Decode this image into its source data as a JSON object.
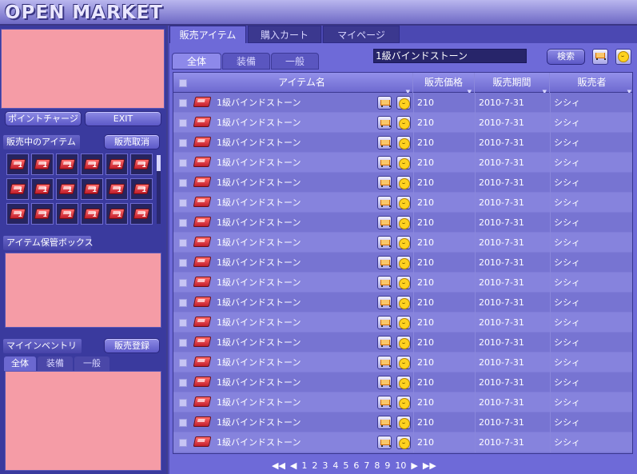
{
  "app": {
    "title": "OPEN MARKET"
  },
  "left": {
    "point_charge": "ポイントチャージ",
    "exit": "EXIT",
    "selling_label": "販売中のアイテム",
    "cancel_sale": "販売取消",
    "storage_label": "アイテム保管ボックス",
    "inventory_label": "マイインベントリ",
    "register_sale": "販売登録",
    "inv_tabs": [
      "全体",
      "装備",
      "一般"
    ],
    "slot_count": "1"
  },
  "main": {
    "tabs": [
      "販売アイテム",
      "購入カート",
      "マイページ"
    ],
    "filter_tabs": [
      "全体",
      "装備",
      "一般"
    ],
    "search_value": "1級バインドストーン",
    "search_button": "検索",
    "headers": [
      "アイテム名",
      "販売価格",
      "販売期間",
      "販売者"
    ],
    "rows": [
      {
        "name": "1級バインドストーン",
        "price": "210",
        "period": "2010-7-31",
        "seller": "シシィ"
      },
      {
        "name": "1級バインドストーン",
        "price": "210",
        "period": "2010-7-31",
        "seller": "シシィ"
      },
      {
        "name": "1級バインドストーン",
        "price": "210",
        "period": "2010-7-31",
        "seller": "シシィ"
      },
      {
        "name": "1級バインドストーン",
        "price": "210",
        "period": "2010-7-31",
        "seller": "シシィ"
      },
      {
        "name": "1級バインドストーン",
        "price": "210",
        "period": "2010-7-31",
        "seller": "シシィ"
      },
      {
        "name": "1級バインドストーン",
        "price": "210",
        "period": "2010-7-31",
        "seller": "シシィ"
      },
      {
        "name": "1級バインドストーン",
        "price": "210",
        "period": "2010-7-31",
        "seller": "シシィ"
      },
      {
        "name": "1級バインドストーン",
        "price": "210",
        "period": "2010-7-31",
        "seller": "シシィ"
      },
      {
        "name": "1級バインドストーン",
        "price": "210",
        "period": "2010-7-31",
        "seller": "シシィ"
      },
      {
        "name": "1級バインドストーン",
        "price": "210",
        "period": "2010-7-31",
        "seller": "シシィ"
      },
      {
        "name": "1級バインドストーン",
        "price": "210",
        "period": "2010-7-31",
        "seller": "シシィ"
      },
      {
        "name": "1級バインドストーン",
        "price": "210",
        "period": "2010-7-31",
        "seller": "シシィ"
      },
      {
        "name": "1級バインドストーン",
        "price": "210",
        "period": "2010-7-31",
        "seller": "シシィ"
      },
      {
        "name": "1級バインドストーン",
        "price": "210",
        "period": "2010-7-31",
        "seller": "シシィ"
      },
      {
        "name": "1級バインドストーン",
        "price": "210",
        "period": "2010-7-31",
        "seller": "シシィ"
      },
      {
        "name": "1級バインドストーン",
        "price": "210",
        "period": "2010-7-31",
        "seller": "シシィ"
      },
      {
        "name": "1級バインドストーン",
        "price": "210",
        "period": "2010-7-31",
        "seller": "シシィ"
      },
      {
        "name": "1級バインドストーン",
        "price": "210",
        "period": "2010-7-31",
        "seller": "シシィ"
      }
    ],
    "pagination": {
      "first": "◀◀",
      "prev": "◀",
      "pages": [
        "1",
        "2",
        "3",
        "4",
        "5",
        "6",
        "7",
        "8",
        "9",
        "10"
      ],
      "next": "▶",
      "last": "▶▶"
    }
  },
  "colors": {
    "accent": "#6e69c4",
    "pink": "#f59ca6",
    "row_a": "#7774d2",
    "row_b": "#8683dd"
  },
  "icons": [
    "stone-icon",
    "cart-icon",
    "smile-icon",
    "checkbox-icon",
    "sort-arrow-icon"
  ]
}
